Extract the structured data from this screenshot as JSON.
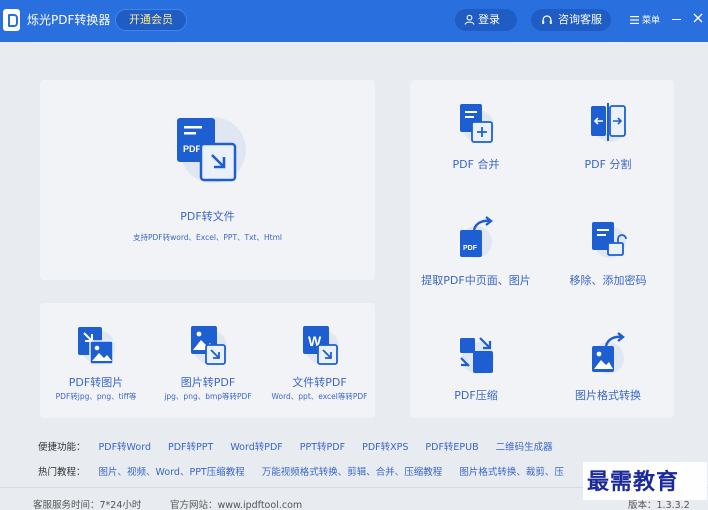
{
  "titlebar": {
    "app_title": "烁光PDF转换器",
    "vip_label": "开通会员",
    "login_label": "登录",
    "service_label": "咨询客服",
    "menu_label": "菜单"
  },
  "main_tool": {
    "label": "PDF转文件",
    "sub": "支持PDF转word、Excel、PPT、Txt、Html"
  },
  "bottom_tools": [
    {
      "label": "PDF转图片",
      "sub": "PDF转jpg、png、tiff等"
    },
    {
      "label": "图片转PDF",
      "sub": "jpg、png、bmp等转PDF"
    },
    {
      "label": "文件转PDF",
      "sub": "Word、ppt、excel等转PDF"
    }
  ],
  "right_tools": [
    {
      "label": "PDF 合并"
    },
    {
      "label": "PDF 分割"
    },
    {
      "label": "提取PDF中页面、图片"
    },
    {
      "label": "移除、添加密码"
    },
    {
      "label": "PDF压缩"
    },
    {
      "label": "图片格式转换"
    }
  ],
  "quick_links": {
    "heading": "便捷功能：",
    "items": [
      "PDF转Word",
      "PDF转PPT",
      "Word转PDF",
      "PPT转PDF",
      "PDF转XPS",
      "PDF转EPUB",
      "二维码生成器"
    ]
  },
  "tutorials": {
    "heading": "热门教程：",
    "items": [
      "图片、视频、Word、PPT压缩教程",
      "万能视频格式转换、剪辑、合并、压缩教程",
      "图片格式转换、裁剪、压"
    ]
  },
  "footer": {
    "service_hours": "客服服务时间：7*24小时",
    "website": "官方网站：www.ipdftool.com",
    "version": "版本：1.3.3.2"
  },
  "watermark": "最需教育",
  "colors": {
    "titlebar": "#2a6fde",
    "accent": "#3a67c9",
    "icon_blue": "#1d5fd1",
    "vip_text": "#ffe889"
  }
}
